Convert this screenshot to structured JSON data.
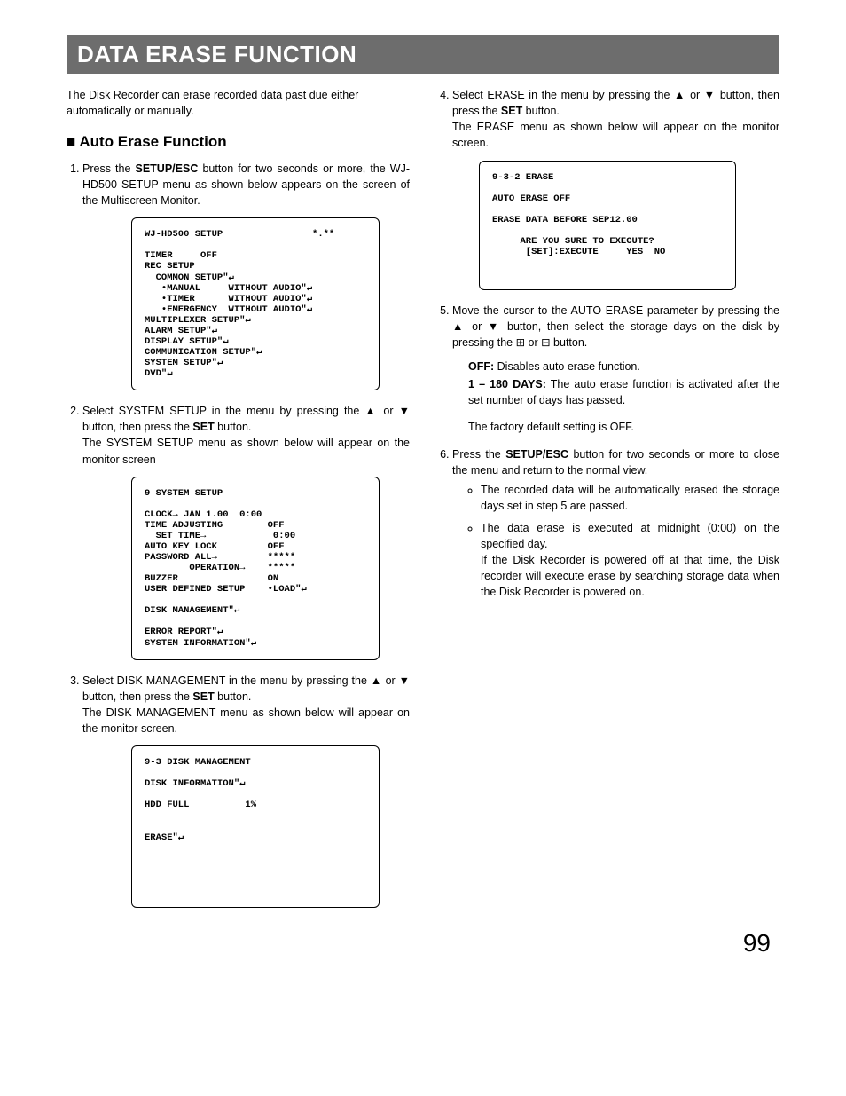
{
  "title": "DATA ERASE FUNCTION",
  "intro": "The Disk Recorder can erase recorded data past due either automatically or manually.",
  "subtitle_marker": "■",
  "subtitle": "Auto Erase Function",
  "step1": {
    "a": "Press the ",
    "b": "SETUP/ESC",
    "c": " button for two seconds or more, the WJ-HD500 SETUP menu as shown below appears on the screen of the Multiscreen Monitor."
  },
  "screen1": "WJ-HD500 SETUP                *.**\n\nTIMER     OFF\nREC SETUP\n  COMMON SETUP\"↵\n   •MANUAL     WITHOUT AUDIO\"↵\n   •TIMER      WITHOUT AUDIO\"↵\n   •EMERGENCY  WITHOUT AUDIO\"↵\nMULTIPLEXER SETUP\"↵\nALARM SETUP\"↵\nDISPLAY SETUP\"↵\nCOMMUNICATION SETUP\"↵\nSYSTEM SETUP\"↵\nDVD\"↵",
  "step2": {
    "a": "Select SYSTEM SETUP in the menu by pressing the ▲ or ▼ button, then press the ",
    "b": "SET",
    "c": " button.",
    "d": "The SYSTEM SETUP menu as shown below will appear on the monitor screen"
  },
  "screen2": "9 SYSTEM SETUP\n\nCLOCK→ JAN 1.00  0:00\nTIME ADJUSTING        OFF\n  SET TIME→            0:00\nAUTO KEY LOCK         OFF\nPASSWORD ALL→         *****\n        OPERATION→    *****\nBUZZER                ON\nUSER DEFINED SETUP    •LOAD\"↵\n\nDISK MANAGEMENT\"↵\n\nERROR REPORT\"↵\nSYSTEM INFORMATION\"↵",
  "step3": {
    "a": "Select DISK MANAGEMENT in the menu by pressing the ▲ or ▼ button, then press the ",
    "b": "SET",
    "c": " button.",
    "d": "The DISK MANAGEMENT menu as shown below will appear on the monitor screen."
  },
  "screen3": "9-3 DISK MANAGEMENT\n\nDISK INFORMATION\"↵\n\nHDD FULL          1%\n\n\nERASE\"↵\n\n\n\n\n\n",
  "step4": {
    "a": "Select ERASE in the menu by pressing the ▲ or ▼ button, then press the ",
    "b": "SET",
    "c": " button.",
    "d": "The ERASE menu as shown below will appear on the monitor screen."
  },
  "screen4": "9-3-2 ERASE\n\nAUTO ERASE OFF\n\nERASE DATA BEFORE SEP12.00\n\n     ARE YOU SURE TO EXECUTE?\n      [SET]:EXECUTE     YES  NO\n\n\n",
  "step5": {
    "a": "Move the cursor to the AUTO ERASE parameter by pressing the ▲ or ▼ button, then select the storage days on the disk by pressing the ⊞ or ⊟ button."
  },
  "defs": {
    "off_label": "OFF:",
    "off_text": " Disables auto erase function.",
    "days_label": "1 – 180 DAYS:",
    "days_text": " The auto erase function is activated after the set number of days has passed."
  },
  "factory": "The factory default setting is OFF.",
  "step6": {
    "a": "Press the ",
    "b": "SETUP/ESC",
    "c": " button for two seconds or more to close the menu and return to the normal view."
  },
  "bul1": "The recorded data will be automatically erased the storage days set in step 5 are passed.",
  "bul2a": "The data erase is executed at midnight (0:00) on the specified day.",
  "bul2b": "If the Disk Recorder is powered off at that time, the Disk recorder will execute erase by searching storage data when the Disk Recorder is powered on.",
  "page_num": "99"
}
